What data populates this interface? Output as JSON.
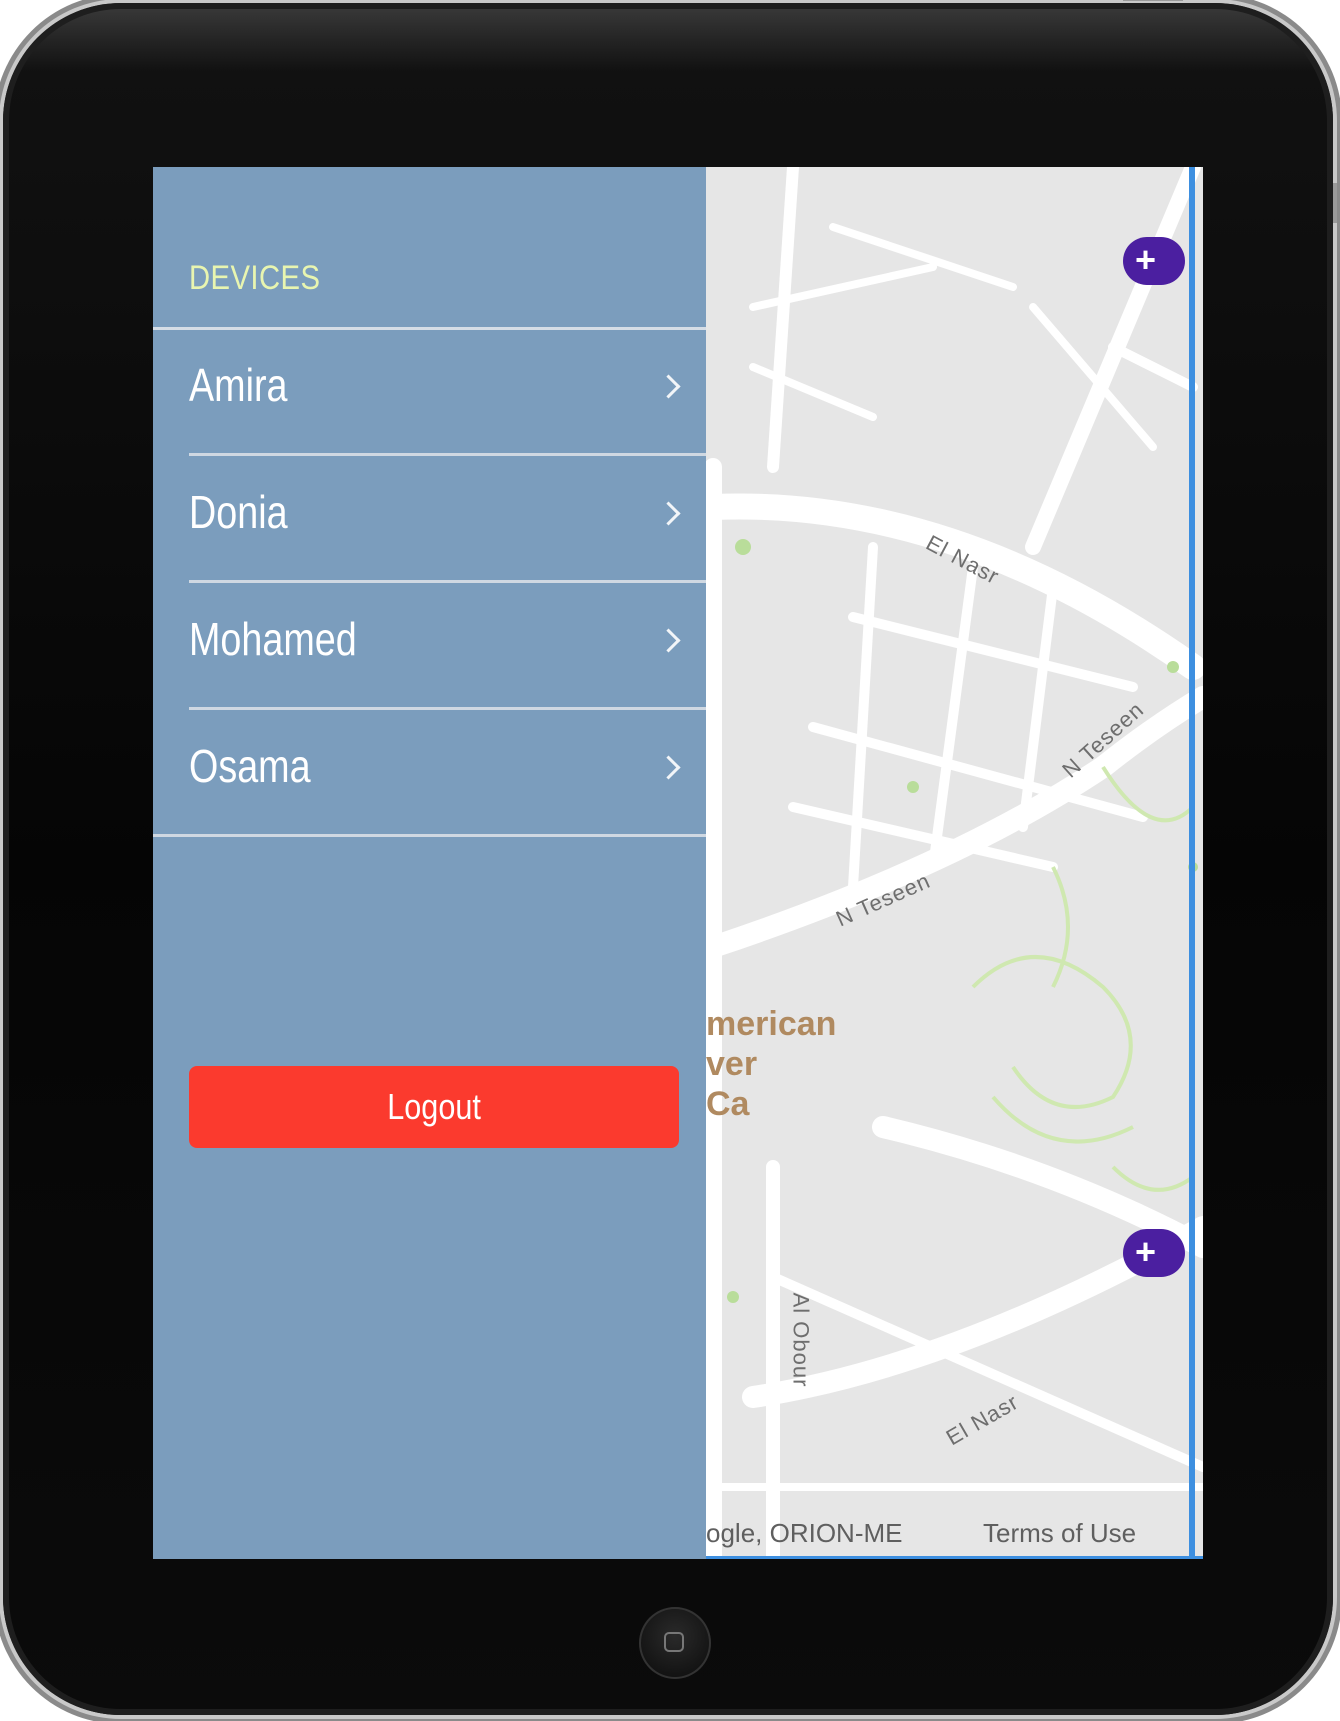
{
  "drawer": {
    "header": "DEVICES",
    "devices": [
      {
        "label": "Amira"
      },
      {
        "label": "Donia"
      },
      {
        "label": "Mohamed"
      },
      {
        "label": "Osama"
      }
    ],
    "logout_label": "Logout"
  },
  "map": {
    "streets": [
      "El Nasr",
      "N Teseen",
      "N Teseen",
      "Al Obour",
      "El Nasr"
    ],
    "place_label_line1": "merican",
    "place_label_line2": "ver",
    "place_label_line3": "Ca",
    "attribution": "ogle, ORION-ME",
    "terms_label": "Terms of Use",
    "zoom_in_label": "+"
  },
  "colors": {
    "drawer_bg": "#7b9dbd",
    "header_text": "#e8f5b0",
    "logout_bg": "#fb3a2e",
    "marker_red": "#c0262c",
    "marker_blue": "#1f4e96"
  },
  "icons": {
    "chevron": "chevron-right-icon",
    "zoom": "plus-icon",
    "location_pin": "location-pin-icon",
    "target": "target-icon"
  }
}
